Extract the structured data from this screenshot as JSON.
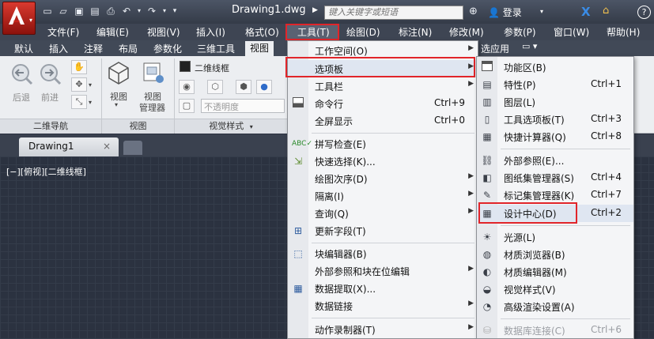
{
  "document_title": "Drawing1.dwg",
  "search": {
    "placeholder": "键入关键字或短语"
  },
  "account": {
    "login_label": "登录"
  },
  "menubar": [
    {
      "label": "文件(F)"
    },
    {
      "label": "编辑(E)"
    },
    {
      "label": "视图(V)"
    },
    {
      "label": "插入(I)"
    },
    {
      "label": "格式(O)"
    },
    {
      "label": "工具(T)"
    },
    {
      "label": "绘图(D)"
    },
    {
      "label": "标注(N)"
    },
    {
      "label": "修改(M)"
    },
    {
      "label": "参数(P)"
    },
    {
      "label": "窗口(W)"
    },
    {
      "label": "帮助(H)"
    }
  ],
  "ribbon_tabs": [
    {
      "label": "默认"
    },
    {
      "label": "插入"
    },
    {
      "label": "注释"
    },
    {
      "label": "布局"
    },
    {
      "label": "参数化"
    },
    {
      "label": "三维工具"
    },
    {
      "label": "视图"
    },
    {
      "label": "选应用"
    }
  ],
  "ribbon": {
    "nav_panel": {
      "back": "后退",
      "forward": "前进",
      "title": "二维导航"
    },
    "view_panel": {
      "view": "视图",
      "view_manager_line1": "视图",
      "view_manager_line2": "管理器",
      "title": "视图"
    },
    "visual_panel": {
      "style_combo": "二维线框",
      "opacity_combo": "不透明度",
      "title": "视觉样式"
    }
  },
  "doc_tab": {
    "label": "Drawing1"
  },
  "viewport_label": "[−][俯视][二维线框]",
  "tools_menu": {
    "items": [
      {
        "label": "工作空间(O)",
        "shortcut": "",
        "submenu": true
      },
      {
        "label": "选项板",
        "shortcut": "",
        "submenu": true
      },
      {
        "label": "工具栏",
        "shortcut": "",
        "submenu": true
      },
      {
        "label": "命令行",
        "shortcut": "Ctrl+9",
        "submenu": false
      },
      {
        "label": "全屏显示",
        "shortcut": "Ctrl+0",
        "submenu": false
      },
      {
        "label": "拼写检查(E)",
        "shortcut": "",
        "submenu": false
      },
      {
        "label": "快速选择(K)...",
        "shortcut": "",
        "submenu": false
      },
      {
        "label": "绘图次序(D)",
        "shortcut": "",
        "submenu": true
      },
      {
        "label": "隔离(I)",
        "shortcut": "",
        "submenu": true
      },
      {
        "label": "查询(Q)",
        "shortcut": "",
        "submenu": true
      },
      {
        "label": "更新字段(T)",
        "shortcut": "",
        "submenu": false
      },
      {
        "label": "块编辑器(B)",
        "shortcut": "",
        "submenu": false
      },
      {
        "label": "外部参照和块在位编辑",
        "shortcut": "",
        "submenu": true
      },
      {
        "label": "数据提取(X)...",
        "shortcut": "",
        "submenu": false
      },
      {
        "label": "数据链接",
        "shortcut": "",
        "submenu": true
      },
      {
        "label": "动作录制器(T)",
        "shortcut": "",
        "submenu": true
      }
    ]
  },
  "palettes_menu": {
    "items": [
      {
        "label": "功能区(B)",
        "shortcut": ""
      },
      {
        "label": "特性(P)",
        "shortcut": "Ctrl+1"
      },
      {
        "label": "图层(L)",
        "shortcut": ""
      },
      {
        "label": "工具选项板(T)",
        "shortcut": "Ctrl+3"
      },
      {
        "label": "快捷计算器(Q)",
        "shortcut": "Ctrl+8"
      },
      {
        "label": "外部参照(E)...",
        "shortcut": ""
      },
      {
        "label": "图纸集管理器(S)",
        "shortcut": "Ctrl+4"
      },
      {
        "label": "标记集管理器(K)",
        "shortcut": "Ctrl+7"
      },
      {
        "label": "设计中心(D)",
        "shortcut": "Ctrl+2"
      },
      {
        "label": "光源(L)",
        "shortcut": ""
      },
      {
        "label": "材质浏览器(B)",
        "shortcut": ""
      },
      {
        "label": "材质编辑器(M)",
        "shortcut": ""
      },
      {
        "label": "视觉样式(V)",
        "shortcut": ""
      },
      {
        "label": "高级渲染设置(A)",
        "shortcut": ""
      },
      {
        "label": "数据库连接(C)",
        "shortcut": "Ctrl+6"
      }
    ]
  },
  "colors": {
    "highlight_red": "#e1252a",
    "brand_red": "#c8261c"
  }
}
